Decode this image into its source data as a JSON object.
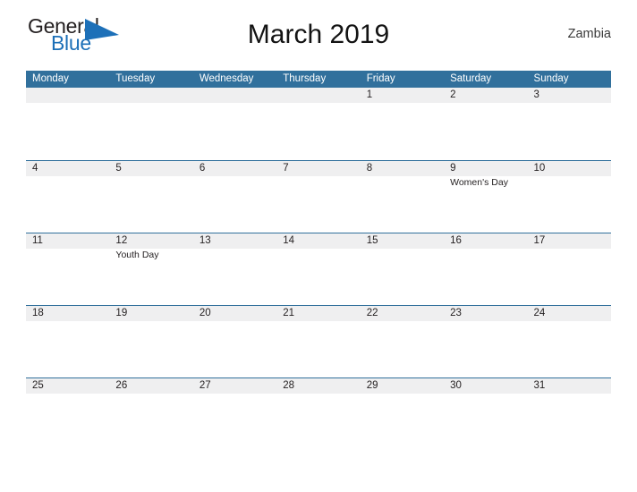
{
  "brand": {
    "word_one": "General",
    "word_two": "Blue",
    "mark_icon": "triangle-flag-icon",
    "mark_color": "#1d70b8",
    "word_one_color": "#231f20",
    "word_two_color": "#1d70b8"
  },
  "header": {
    "title": "March 2019",
    "region": "Zambia"
  },
  "theme": {
    "header_bar_color": "#31709c",
    "date_band_color": "#efeff0",
    "rule_color": "#31709c",
    "text_color": "#231f20",
    "background": "#ffffff"
  },
  "calendar": {
    "month": "March",
    "year": "2019",
    "weekday_headers": [
      "Monday",
      "Tuesday",
      "Wednesday",
      "Thursday",
      "Friday",
      "Saturday",
      "Sunday"
    ],
    "weeks": [
      {
        "days": [
          {
            "num": "",
            "events": []
          },
          {
            "num": "",
            "events": []
          },
          {
            "num": "",
            "events": []
          },
          {
            "num": "",
            "events": []
          },
          {
            "num": "1",
            "events": []
          },
          {
            "num": "2",
            "events": []
          },
          {
            "num": "3",
            "events": []
          }
        ]
      },
      {
        "days": [
          {
            "num": "4",
            "events": []
          },
          {
            "num": "5",
            "events": []
          },
          {
            "num": "6",
            "events": []
          },
          {
            "num": "7",
            "events": []
          },
          {
            "num": "8",
            "events": []
          },
          {
            "num": "9",
            "events": [
              "Women's Day"
            ]
          },
          {
            "num": "10",
            "events": []
          }
        ]
      },
      {
        "days": [
          {
            "num": "11",
            "events": []
          },
          {
            "num": "12",
            "events": [
              "Youth Day"
            ]
          },
          {
            "num": "13",
            "events": []
          },
          {
            "num": "14",
            "events": []
          },
          {
            "num": "15",
            "events": []
          },
          {
            "num": "16",
            "events": []
          },
          {
            "num": "17",
            "events": []
          }
        ]
      },
      {
        "days": [
          {
            "num": "18",
            "events": []
          },
          {
            "num": "19",
            "events": []
          },
          {
            "num": "20",
            "events": []
          },
          {
            "num": "21",
            "events": []
          },
          {
            "num": "22",
            "events": []
          },
          {
            "num": "23",
            "events": []
          },
          {
            "num": "24",
            "events": []
          }
        ]
      },
      {
        "days": [
          {
            "num": "25",
            "events": []
          },
          {
            "num": "26",
            "events": []
          },
          {
            "num": "27",
            "events": []
          },
          {
            "num": "28",
            "events": []
          },
          {
            "num": "29",
            "events": []
          },
          {
            "num": "30",
            "events": []
          },
          {
            "num": "31",
            "events": []
          }
        ]
      }
    ]
  }
}
